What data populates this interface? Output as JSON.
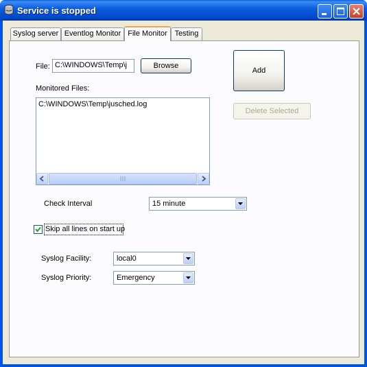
{
  "window": {
    "title": "Service is stopped"
  },
  "tabs": [
    {
      "label": "Syslog server"
    },
    {
      "label": "Eventlog Monitor"
    },
    {
      "label": "File Monitor"
    },
    {
      "label": "Testing"
    }
  ],
  "active_tab": "File Monitor",
  "file_monitor": {
    "file_label": "File:",
    "file_value": "C:\\WINDOWS\\Temp\\j",
    "browse_label": "Browse",
    "add_label": "Add",
    "monitored_files_label": "Monitored Files:",
    "monitored_files": [
      "C:\\WINDOWS\\Temp\\jusched.log"
    ],
    "delete_selected_label": "Delete Selected",
    "check_interval_label": "Check Interval",
    "check_interval_value": "15 minute",
    "skip_lines_label": "Skip all lines on start up",
    "skip_lines_checked": true,
    "syslog_facility_label": "Syslog Facility:",
    "syslog_facility_value": "local0",
    "syslog_priority_label": "Syslog Priority:",
    "syslog_priority_value": "Emergency"
  },
  "icons": [
    "app-icon",
    "minimize-icon",
    "maximize-icon",
    "close-icon",
    "scroll-left-icon",
    "scroll-right-icon",
    "scroll-grip-icon",
    "chevron-down-icon",
    "checkmark-icon"
  ],
  "colors": {
    "titlebar": "#0054e3",
    "dialog_bg": "#ece9d8",
    "tab_accent": "#f3a44a",
    "close_button": "#c8402a"
  }
}
